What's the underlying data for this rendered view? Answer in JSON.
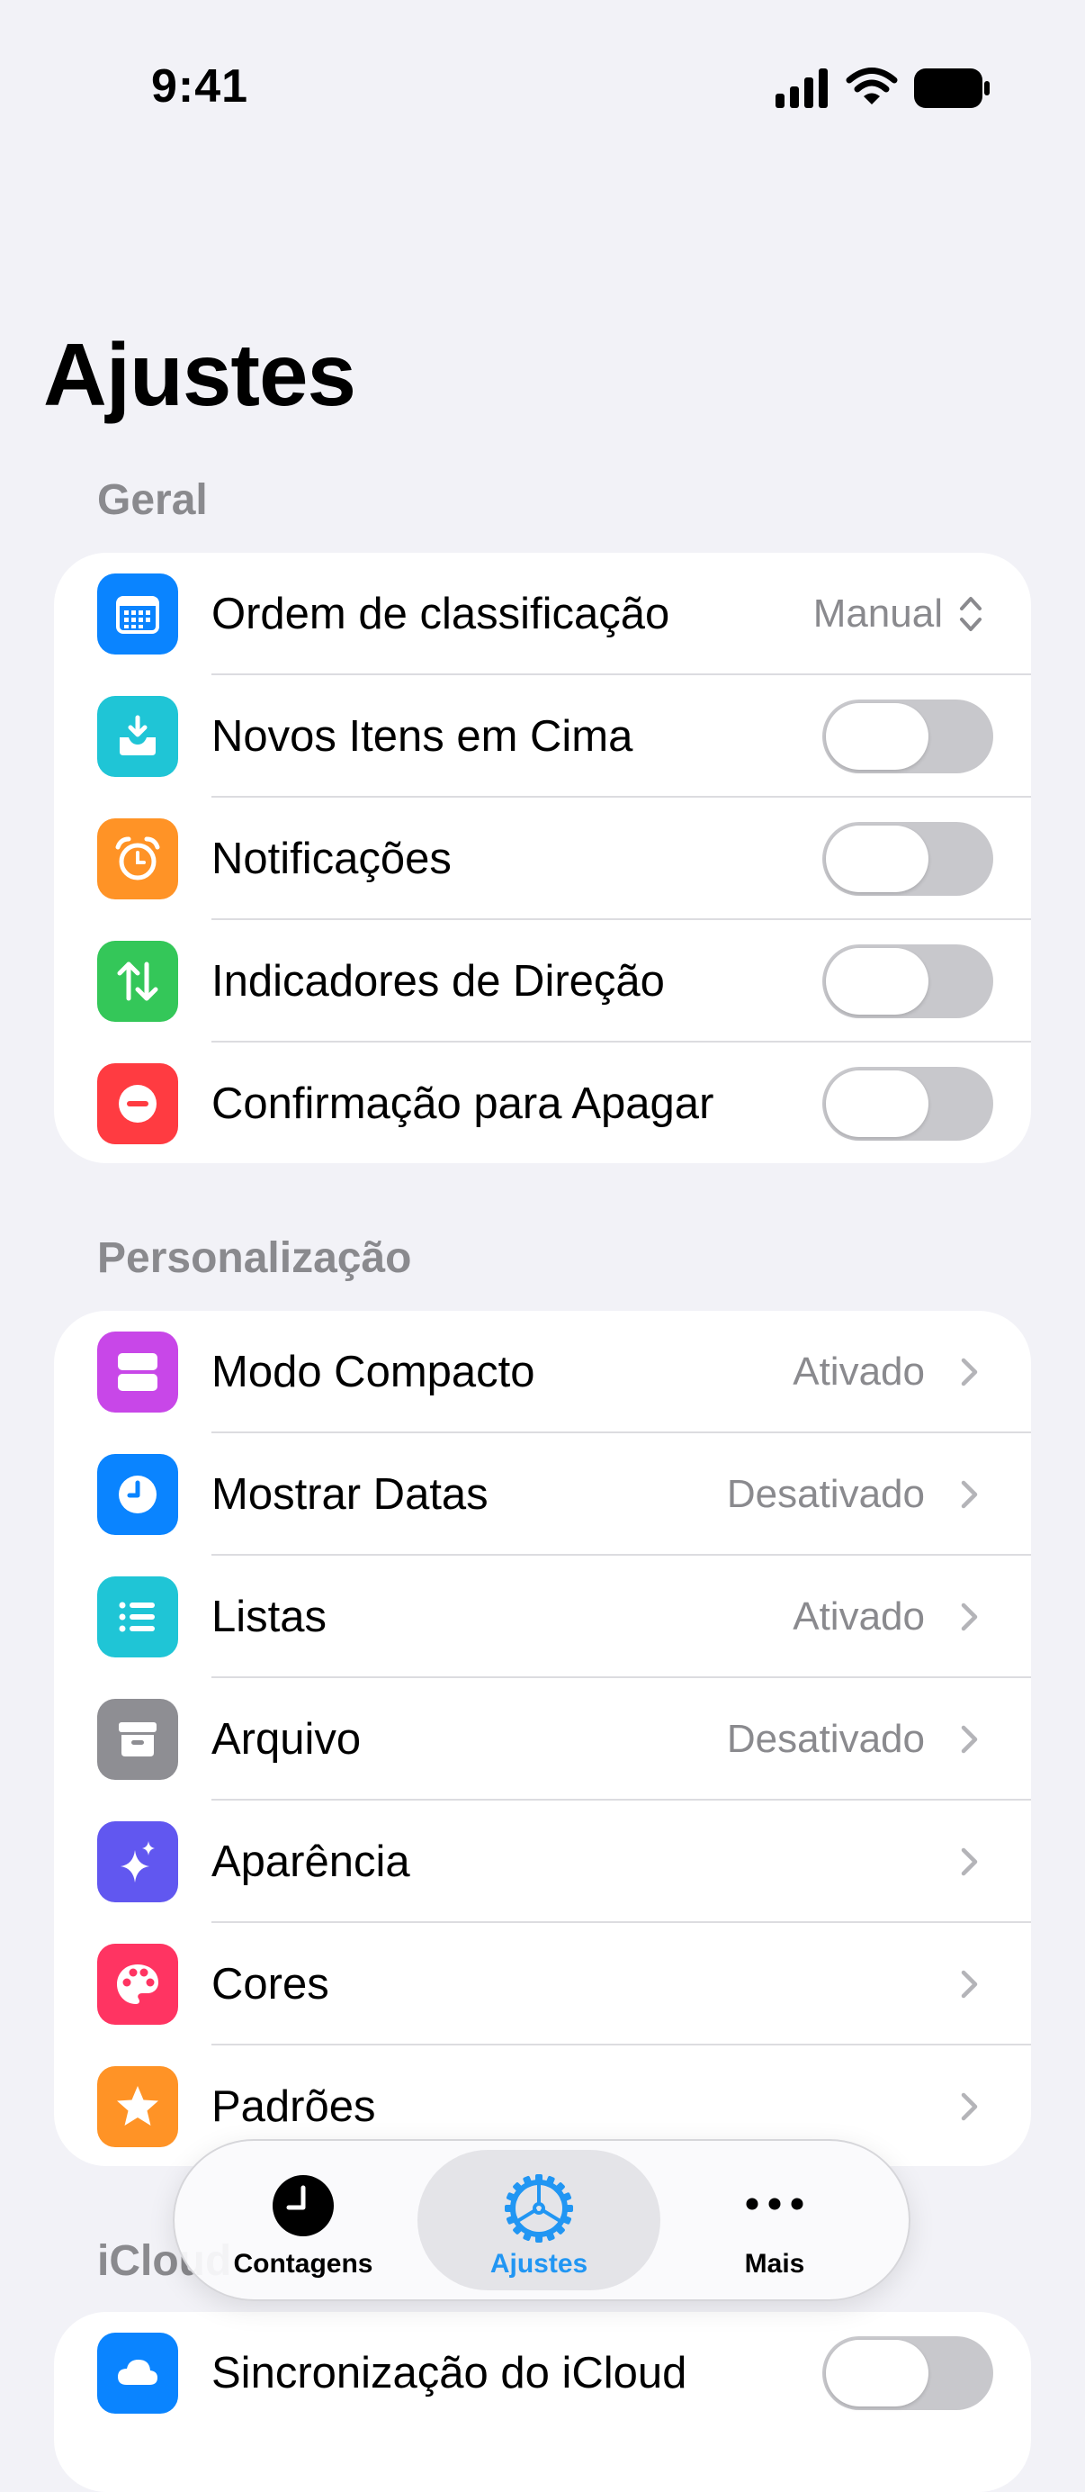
{
  "status_bar": {
    "time": "9:41"
  },
  "title": "Ajustes",
  "sections": {
    "general": {
      "header": "Geral",
      "sort_order": {
        "label": "Ordem de classificação",
        "value": "Manual"
      },
      "new_items_top": {
        "label": "Novos Itens em Cima",
        "on": false
      },
      "notifications": {
        "label": "Notificações",
        "on": false
      },
      "direction_indicators": {
        "label": "Indicadores de Direção",
        "on": false
      },
      "delete_confirmation": {
        "label": "Confirmação para Apagar",
        "on": false
      }
    },
    "personalization": {
      "header": "Personalização",
      "compact_mode": {
        "label": "Modo Compacto",
        "value": "Ativado"
      },
      "show_dates": {
        "label": "Mostrar Datas",
        "value": "Desativado"
      },
      "lists": {
        "label": "Listas",
        "value": "Ativado"
      },
      "archive": {
        "label": "Arquivo",
        "value": "Desativado"
      },
      "appearance": {
        "label": "Aparência"
      },
      "colors": {
        "label": "Cores"
      },
      "defaults": {
        "label": "Padrões"
      }
    },
    "icloud": {
      "header": "iCloud",
      "sync": {
        "label": "Sincronização do iCloud"
      }
    }
  },
  "tab_bar": {
    "counts": "Contagens",
    "settings": "Ajustes",
    "more": "Mais"
  },
  "colors": {
    "accent": "#2196f3",
    "tile_blue": "#0a84ff",
    "tile_cyan": "#1fc5d6",
    "tile_orange": "#ff9326",
    "tile_green": "#34c759",
    "tile_red": "#ff3b41",
    "tile_magenta": "#c847e8",
    "tile_gray": "#8e8e93",
    "tile_indigo": "#6157f0",
    "tile_pink": "#ff3462"
  }
}
